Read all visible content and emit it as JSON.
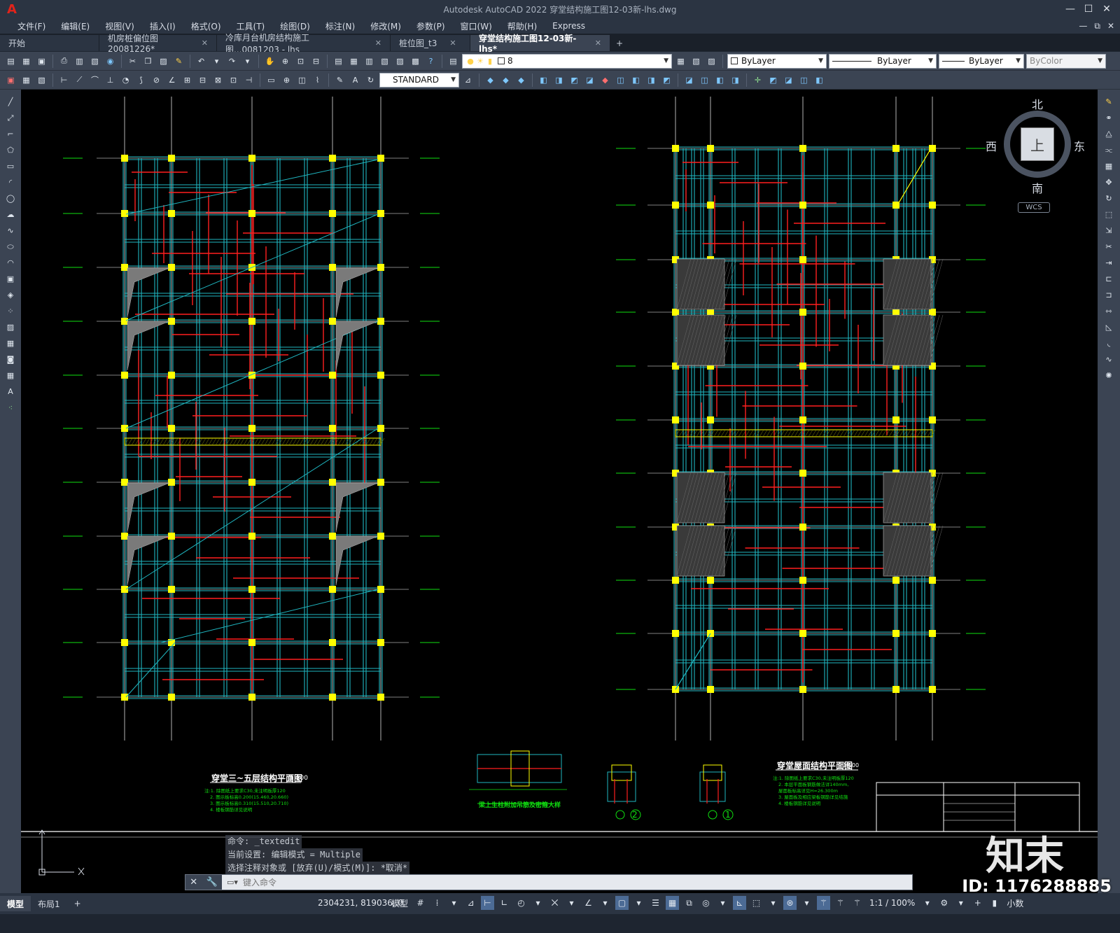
{
  "app": {
    "title": "Autodesk AutoCAD 2022    穿堂结构施工图12-03新-lhs.dwg",
    "logo": "A",
    "min_icon": "—",
    "max_icon": "☐",
    "close_icon": "✕"
  },
  "menu": {
    "items": [
      "文件(F)",
      "编辑(E)",
      "视图(V)",
      "插入(I)",
      "格式(O)",
      "工具(T)",
      "绘图(D)",
      "标注(N)",
      "修改(M)",
      "参数(P)",
      "窗口(W)",
      "帮助(H)",
      "Express"
    ],
    "right": [
      "—",
      "⧉",
      "✕"
    ]
  },
  "tabs": [
    {
      "label": "开始",
      "close": ""
    },
    {
      "label": "机房桩偏位图20081226*",
      "close": "✕"
    },
    {
      "label": "冷库月台机房结构施工图...0081203 - lhs",
      "close": "✕"
    },
    {
      "label": "桩位图_t3",
      "close": "✕"
    },
    {
      "label": "穿堂结构施工图12-03新-lhs*",
      "close": "✕"
    }
  ],
  "tab_add": "+",
  "properties": {
    "layer": "8",
    "color": "ByLayer",
    "linetype": "ByLayer",
    "lineweight": "ByLayer",
    "plotstyle": "ByColor",
    "textstyle": "STANDARD"
  },
  "viewcube": {
    "north": "北",
    "south": "南",
    "east": "东",
    "west": "西",
    "top": "上",
    "wcs": "WCS"
  },
  "drawing": {
    "left_title": "穿堂三~五层结构平面图",
    "left_scale": "1:100",
    "left_notes": [
      "注:1. 除图纸上要求C30,未注明板厚120",
      "2. 图示板标高0.200(15.460,20.660)",
      "3. 图示板标高0.310(15.510,20.710)",
      "4. 楼板钢筋详见说明"
    ],
    "right_title": "穿堂屋面结构平面图",
    "right_scale": "1:100",
    "right_notes": [
      "注:1. 除图纸上要求C30,未注明板厚120",
      "2. 本层平面板钢筋做法详140mm,",
      "屋面板标高详见H=26.300m",
      "3. 屋面板及相应梁板钢筋详见结施",
      "4. 楼板钢筋详见说明"
    ],
    "detail_title": "梁上生柱附加吊筋及密箍大样",
    "section1": "1",
    "section2": "2"
  },
  "command": {
    "history": [
      "命令: _textedit",
      "当前设置: 编辑模式 = Multiple",
      "选择注释对象或 [放弃(U)/模式(M)]: *取消*"
    ],
    "placeholder": "键入命令"
  },
  "layout_tabs": [
    "模型",
    "布局1",
    "+"
  ],
  "status": {
    "coords": "2304231, 819036, 0",
    "model": "模型",
    "annotation_scale": "1:1 / 100%",
    "units": "小数"
  },
  "watermark": {
    "id": "ID: 1176288885",
    "brand": "知末"
  },
  "colors": {
    "background": "#000000",
    "beam": "#1fb6c0",
    "rebar": "#ff1f1f",
    "column": "#ffff00",
    "axis": "#ffffff",
    "green": "#10e010",
    "chrome": "#3b4453"
  }
}
